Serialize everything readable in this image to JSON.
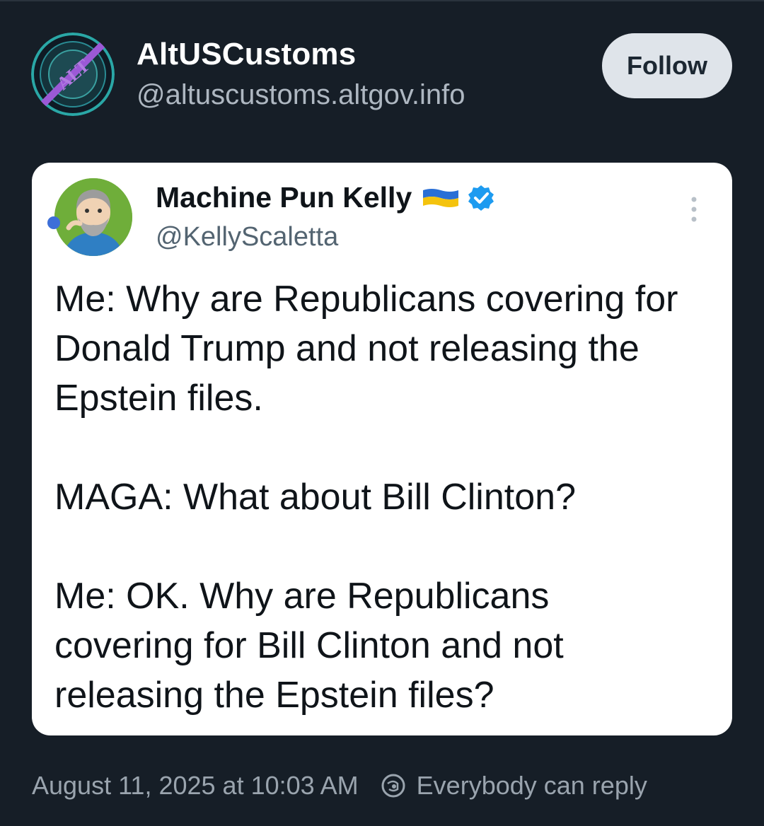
{
  "account": {
    "display_name": "AltUSCustoms",
    "handle": "@altuscustoms.altgov.info",
    "avatar_icon": "alt-customs-seal-icon",
    "avatar_text": "ALT",
    "follow_label": "Follow"
  },
  "quoted_post": {
    "author_name": "Machine Pun Kelly",
    "author_handle": "@KellyScaletta",
    "avatar_icon": "cartoon-avatar-icon",
    "flag_icon": "ukraine-flag-icon",
    "verified_icon": "verified-badge-icon",
    "more_icon": "more-vertical-icon",
    "paragraphs": [
      "Me: Why are Republicans covering for Donald Trump and not releasing the Epstein files.",
      "MAGA: What about Bill Clinton?",
      "Me: OK. Why are Republicans covering for Bill Clinton and not releasing the Epstein files?"
    ]
  },
  "footer": {
    "timestamp": "August 11, 2025 at 10:03 AM",
    "reply_icon": "reply-setting-icon",
    "reply_setting": "Everybody can reply"
  },
  "colors": {
    "background": "#161e27",
    "card": "#ffffff",
    "verified": "#1d9bf0",
    "seal_accent": "#9b59d6"
  }
}
